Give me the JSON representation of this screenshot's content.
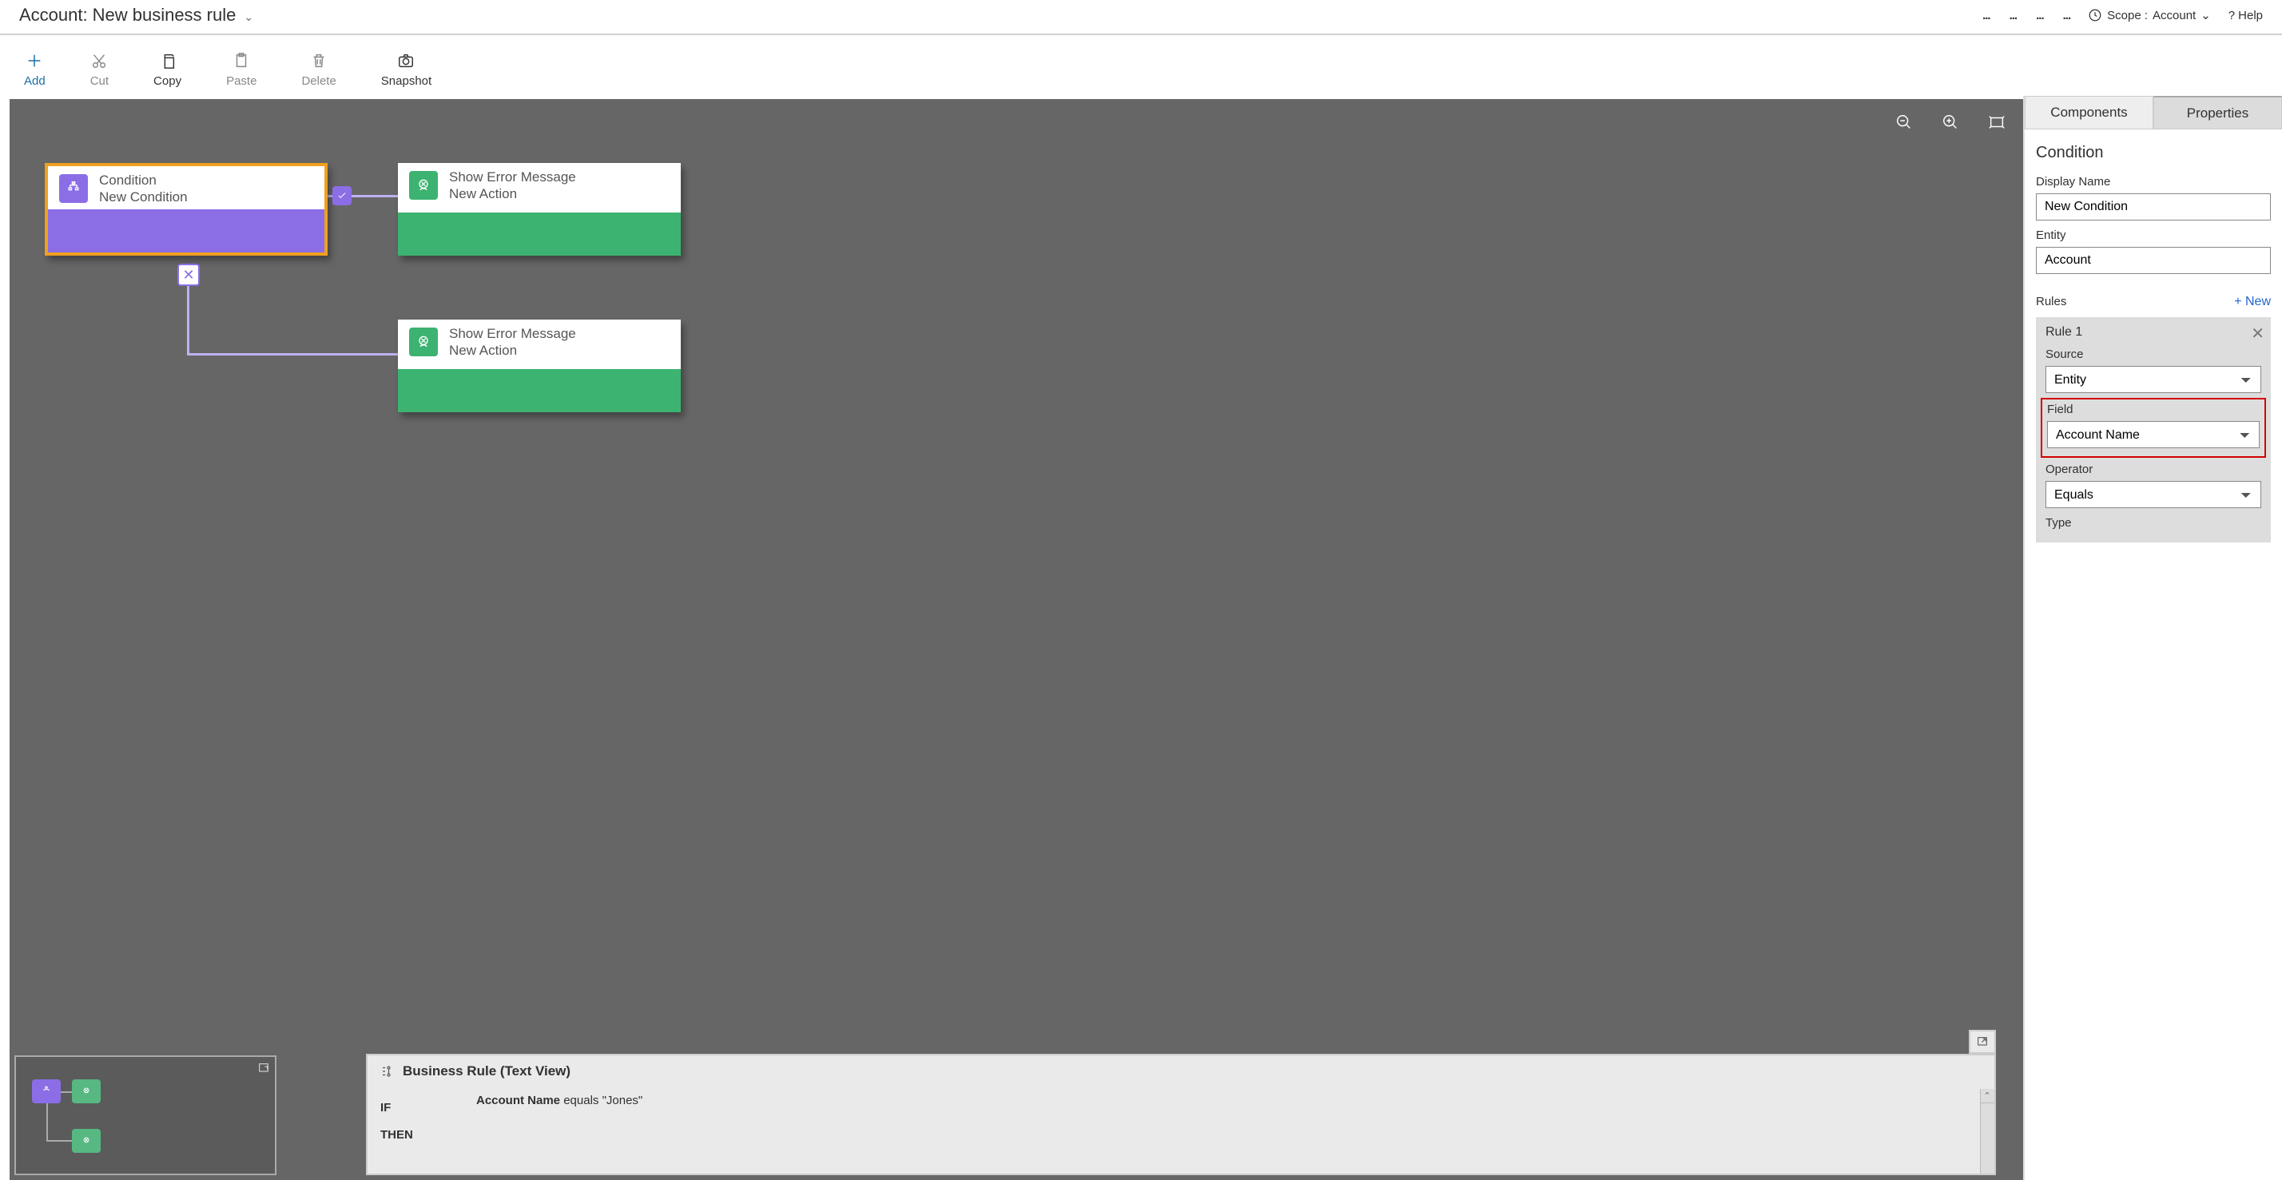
{
  "header": {
    "entity": "Account:",
    "title": "New business rule",
    "scope_label": "Scope :",
    "scope_value": "Account",
    "help": "Help"
  },
  "toolbar": {
    "add": "Add",
    "cut": "Cut",
    "copy": "Copy",
    "paste": "Paste",
    "delete": "Delete",
    "snapshot": "Snapshot"
  },
  "canvas": {
    "condition": {
      "title": "Condition",
      "subtitle": "New Condition"
    },
    "action1": {
      "title": "Show Error Message",
      "subtitle": "New Action"
    },
    "action2": {
      "title": "Show Error Message",
      "subtitle": "New Action"
    }
  },
  "textview": {
    "heading": "Business Rule (Text View)",
    "if": "IF",
    "then": "THEN",
    "cond_field": "Account Name",
    "cond_rest": " equals \"Jones\""
  },
  "panel": {
    "tab_components": "Components",
    "tab_properties": "Properties",
    "heading": "Condition",
    "display_name_label": "Display Name",
    "display_name_value": "New Condition",
    "entity_label": "Entity",
    "entity_value": "Account",
    "rules_label": "Rules",
    "new": "+  New",
    "rule1": "Rule 1",
    "source_label": "Source",
    "source_value": "Entity",
    "field_label": "Field",
    "field_value": "Account Name",
    "operator_label": "Operator",
    "operator_value": "Equals",
    "type_label": "Type"
  }
}
